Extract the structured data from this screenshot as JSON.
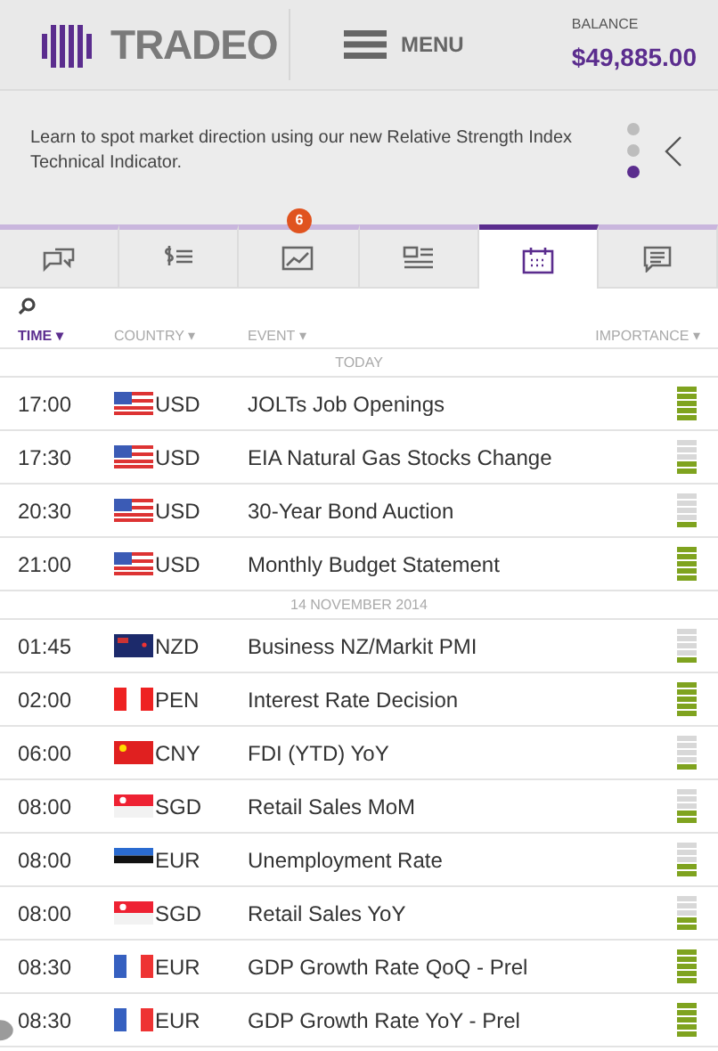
{
  "header": {
    "logo": "TRADEO",
    "menu": "MENU",
    "balance_label": "BALANCE",
    "balance": "$49,885.00"
  },
  "banner": {
    "text": "Learn to spot market direction using our new Relative Strength Index Technical Indicator.",
    "dots": [
      {
        "selected": false
      },
      {
        "selected": false
      },
      {
        "selected": true
      }
    ]
  },
  "tabs": [
    {
      "kind": "chat",
      "selected": false
    },
    {
      "kind": "price-list",
      "selected": false
    },
    {
      "kind": "chart",
      "selected": false,
      "badge": "6"
    },
    {
      "kind": "news",
      "selected": false
    },
    {
      "kind": "calendar",
      "selected": true
    },
    {
      "kind": "message",
      "selected": false
    }
  ],
  "columns": [
    {
      "label": "TIME",
      "selected": true,
      "caret": "▾"
    },
    {
      "label": "COUNTRY",
      "selected": false,
      "caret": "▾"
    },
    {
      "label": "EVENT",
      "selected": false,
      "caret": "▾"
    },
    {
      "label": "IMPORTANCE",
      "selected": false,
      "caret": "▾"
    }
  ],
  "groups": [
    {
      "date": "TODAY",
      "rows": [
        {
          "time": "17:00",
          "kind": "us",
          "currency": "USD",
          "event": "JOLTs Job Openings",
          "level": 1
        },
        {
          "time": "17:30",
          "kind": "us",
          "currency": "USD",
          "event": "EIA Natural Gas Stocks Change",
          "level": 0.4
        },
        {
          "time": "20:30",
          "kind": "us",
          "currency": "USD",
          "event": "30-Year Bond Auction",
          "level": 0.2
        },
        {
          "time": "21:00",
          "kind": "us",
          "currency": "USD",
          "event": "Monthly Budget Statement",
          "level": 1
        }
      ]
    },
    {
      "date": "14 NOVEMBER 2014",
      "rows": [
        {
          "time": "01:45",
          "kind": "nz",
          "currency": "NZD",
          "event": "Business NZ/Markit PMI",
          "level": 0.2
        },
        {
          "time": "02:00",
          "kind": "pe",
          "currency": "PEN",
          "event": "Interest Rate Decision",
          "level": 1
        },
        {
          "time": "06:00",
          "kind": "cn",
          "currency": "CNY",
          "event": "FDI (YTD) YoY",
          "level": 0.2
        },
        {
          "time": "08:00",
          "kind": "sg",
          "currency": "SGD",
          "event": "Retail Sales MoM",
          "level": 0.4
        },
        {
          "time": "08:00",
          "kind": "ee",
          "currency": "EUR",
          "event": "Unemployment Rate",
          "level": 0.4
        },
        {
          "time": "08:00",
          "kind": "sg",
          "currency": "SGD",
          "event": "Retail Sales YoY",
          "level": 0.4
        },
        {
          "time": "08:30",
          "kind": "fr",
          "currency": "EUR",
          "event": "GDP Growth Rate QoQ - Prel",
          "level": 1
        },
        {
          "time": "08:30",
          "kind": "fr",
          "currency": "EUR",
          "event": "GDP Growth Rate YoY - Prel",
          "level": 1
        }
      ]
    }
  ]
}
